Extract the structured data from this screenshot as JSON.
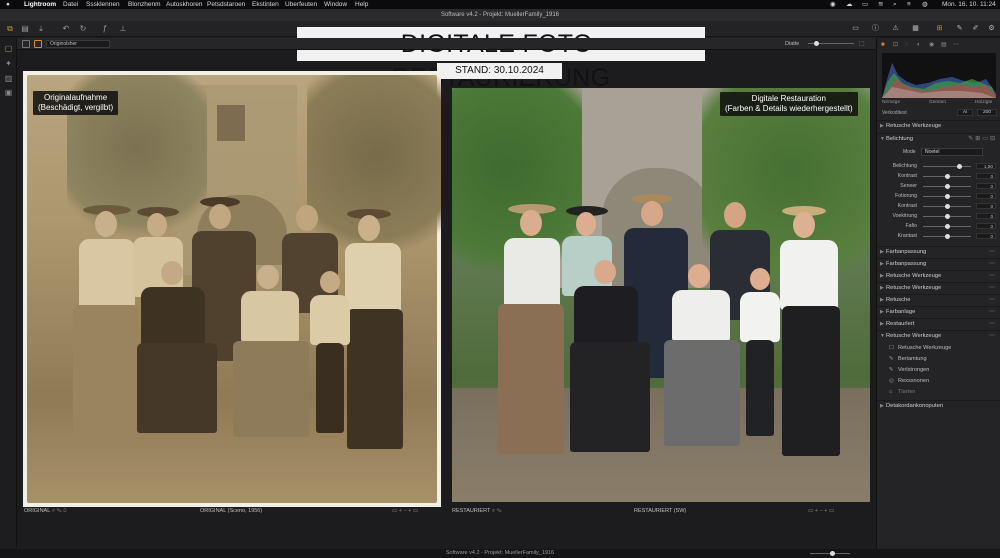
{
  "menubar": {
    "app_name": "Lightroom",
    "menus": [
      "Datei",
      "Sssklennen",
      "Blonzhenm",
      "Autoskhoren",
      "Petsdstaroen",
      "Ekstinten",
      "Uberfeuten",
      "Window",
      "Help"
    ],
    "clock": "Mon. 16. 10. 11:24"
  },
  "window_title": "Software v4.2 - Projekt: MuellerFamily_1916",
  "toolbar": {
    "source_selector": "Originolsher",
    "right_label": "Diatte"
  },
  "overlay": {
    "title": "DIGITALE FOTO-RESTAURIERUNG",
    "stand": "STAND: 30.10.2024"
  },
  "left_view": {
    "caption_line1": "Originalaufnahme",
    "caption_line2": "(Beschädigt, vergilbt)",
    "footer_left": "ORIGINAL",
    "footer_center": "ORIGINAL (Sceno, 1956)"
  },
  "right_view": {
    "caption_line1": "Digitale Restauration",
    "caption_line2": "(Farben & Details wiederhergestellt)",
    "footer_left": "RESTAURIERT",
    "footer_center": "RESTAURIERT (SW)"
  },
  "statusbar": {
    "text": "Software v4.2 - Projekt: MuellerFamily_1916"
  },
  "panel": {
    "histogram_labels": [
      "Nirmege",
      "Gemten",
      "Hoizigte"
    ],
    "readout_label": "Verkoditest",
    "readout_a": "Ai",
    "readout_b": "200",
    "modus_label": "Mode",
    "modus_value": "Noetel",
    "sections_top": [
      {
        "label": "Retusche Werkzeuge",
        "open": false
      },
      {
        "label": "Belichtung",
        "open": true
      }
    ],
    "sliders": [
      {
        "label": "Belichtung",
        "value": "1,50",
        "pos": 0.75
      },
      {
        "label": "Kontrast",
        "value": "0",
        "pos": 0.5
      },
      {
        "label": "Seneer",
        "value": "0",
        "pos": 0.5
      },
      {
        "label": "Fotiorung",
        "value": "0",
        "pos": 0.5
      },
      {
        "label": "Kontrast",
        "value": "0",
        "pos": 0.5
      },
      {
        "label": "Voekitrung",
        "value": "0",
        "pos": 0.5
      },
      {
        "label": "Fafio",
        "value": "0",
        "pos": 0.5
      },
      {
        "label": "Krantast",
        "value": "0",
        "pos": 0.5
      }
    ],
    "sections_mid": [
      {
        "label": "Farbanpassung"
      },
      {
        "label": "Farbanpassung"
      },
      {
        "label": "Retusche Werkzeuge"
      },
      {
        "label": "Retusche Werkzeuge"
      },
      {
        "label": "Retusche"
      },
      {
        "label": "Farbanlage"
      },
      {
        "label": "Restaurlert"
      },
      {
        "label": "Retusche Werkzeuge"
      }
    ],
    "subitems": [
      {
        "icon": "☐",
        "label": "Retusche Werkzeuge"
      },
      {
        "icon": "✎",
        "label": "Beriamtung"
      },
      {
        "icon": "✎",
        "label": "Verlstrongen"
      },
      {
        "icon": "◎",
        "label": "Rexssnonen"
      },
      {
        "icon": "⌂",
        "label": "Tlarten"
      }
    ],
    "section_bottom": "Detakordankonoputen"
  },
  "colors": {
    "accent": "#d98a2b",
    "panel_bg": "#242426",
    "window_bg": "#1c1c1e"
  }
}
